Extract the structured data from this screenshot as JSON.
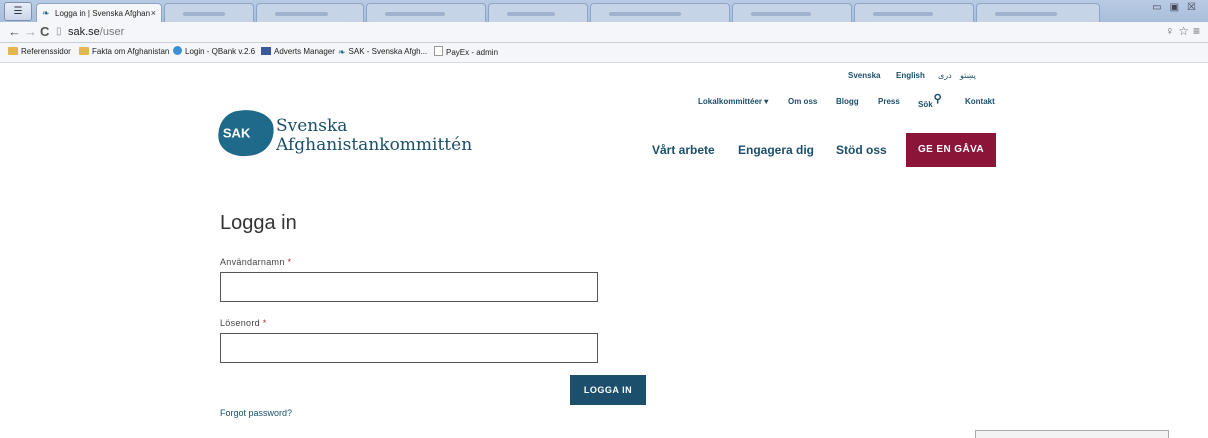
{
  "browser": {
    "active_tab": "Logga in | Svenska Afghan",
    "url_host": "sak.se",
    "url_path": "/user"
  },
  "bookmarks": [
    {
      "label": "Referenssidor",
      "icon": "folder-icon"
    },
    {
      "label": "Fakta om Afghanistan",
      "icon": "folder-icon"
    },
    {
      "label": "Login - QBank v.2.6",
      "icon": "globe-icon"
    },
    {
      "label": "Adverts Manager",
      "icon": "facebook-icon"
    },
    {
      "label": "SAK - Svenska Afgh...",
      "icon": "leaf-icon"
    },
    {
      "label": "PayEx - admin",
      "icon": "page-icon"
    }
  ],
  "header": {
    "languages": [
      "Svenska",
      "English",
      "دری",
      "پښتو"
    ],
    "utility_links": {
      "local": "Lokalkommittéer",
      "about": "Om oss",
      "blog": "Blogg",
      "press": "Press",
      "search": "Sök",
      "contact": "Kontakt"
    },
    "logo": {
      "badge": "SAK",
      "line1": "Svenska",
      "line2": "Afghanistankommittén"
    },
    "main_nav": [
      "Vårt arbete",
      "Engagera dig",
      "Stöd oss"
    ],
    "donate": "GE EN GÅVA"
  },
  "login": {
    "title": "Logga in",
    "username_label": "Användarnamn",
    "password_label": "Lösenord",
    "required_mark": "*",
    "username_value": "",
    "password_value": "",
    "submit": "LOGGA IN",
    "forgot": "Forgot password?"
  },
  "colors": {
    "brand_blue": "#1b4f6b",
    "logo_teal": "#1f6a8a",
    "donate_red": "#8a1538"
  }
}
